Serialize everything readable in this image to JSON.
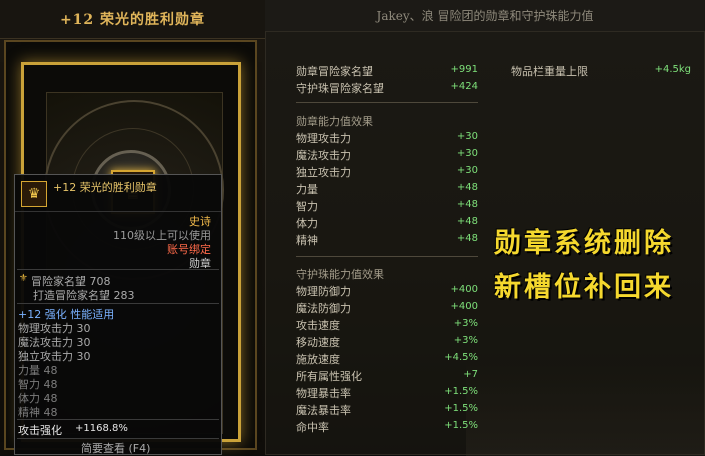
{
  "left": {
    "title": "+12 荣光的胜利勋章"
  },
  "tooltip": {
    "name": "+12 荣光的胜利勋章",
    "rarity": "史诗",
    "level_req": "110级以上可以使用",
    "bind": "账号绑定",
    "category": "勋章",
    "fame": "冒险家名望 708",
    "craft_fame": "打造冒险家名望 283",
    "reinforce": "+12 强化 性能适用",
    "stats": [
      {
        "label": "物理攻击力 30"
      },
      {
        "label": "魔法攻击力 30"
      },
      {
        "label": "独立攻击力 30"
      },
      {
        "label": "力量 48"
      },
      {
        "label": "智力 48"
      },
      {
        "label": "体力 48"
      },
      {
        "label": "精神 48"
      }
    ],
    "attack_boost_label": "攻击强化",
    "attack_boost_value": "+1168.8%",
    "footer": "简要查看 (F4)"
  },
  "right": {
    "header": "Jakey、浪 冒险团的勋章和守护珠能力值",
    "fame_rows": [
      {
        "label": "勋章冒险家名望",
        "value": "+991"
      },
      {
        "label": "守护珠冒险家名望",
        "value": "+424"
      }
    ],
    "inventory": {
      "label": "物品栏重量上限",
      "value": "+4.5kg"
    },
    "medal_section": "勋章能力值效果",
    "medal_stats": [
      {
        "label": "物理攻击力",
        "value": "+30"
      },
      {
        "label": "魔法攻击力",
        "value": "+30"
      },
      {
        "label": "独立攻击力",
        "value": "+30"
      },
      {
        "label": "力量",
        "value": "+48"
      },
      {
        "label": "智力",
        "value": "+48"
      },
      {
        "label": "体力",
        "value": "+48"
      },
      {
        "label": "精神",
        "value": "+48"
      }
    ],
    "guard_section": "守护珠能力值效果",
    "guard_stats": [
      {
        "label": "物理防御力",
        "value": "+400"
      },
      {
        "label": "魔法防御力",
        "value": "+400"
      },
      {
        "label": "攻击速度",
        "value": "+3%"
      },
      {
        "label": "移动速度",
        "value": "+3%"
      },
      {
        "label": "施放速度",
        "value": "+4.5%"
      },
      {
        "label": "所有属性强化",
        "value": "+7"
      },
      {
        "label": "物理暴击率",
        "value": "+1.5%"
      },
      {
        "label": "魔法暴击率",
        "value": "+1.5%"
      },
      {
        "label": "命中率",
        "value": "+1.5%"
      }
    ],
    "promo_line1": "勋章系统删除",
    "promo_line2": "新槽位补回来"
  },
  "colors": {
    "gold": "#e0b55a",
    "value_green": "#7ee07a",
    "promo_yellow": "#f5d82e",
    "bind_red": "#ff6a4a"
  },
  "icons": {
    "medal": "medal-icon",
    "fame": "fame-icon"
  }
}
